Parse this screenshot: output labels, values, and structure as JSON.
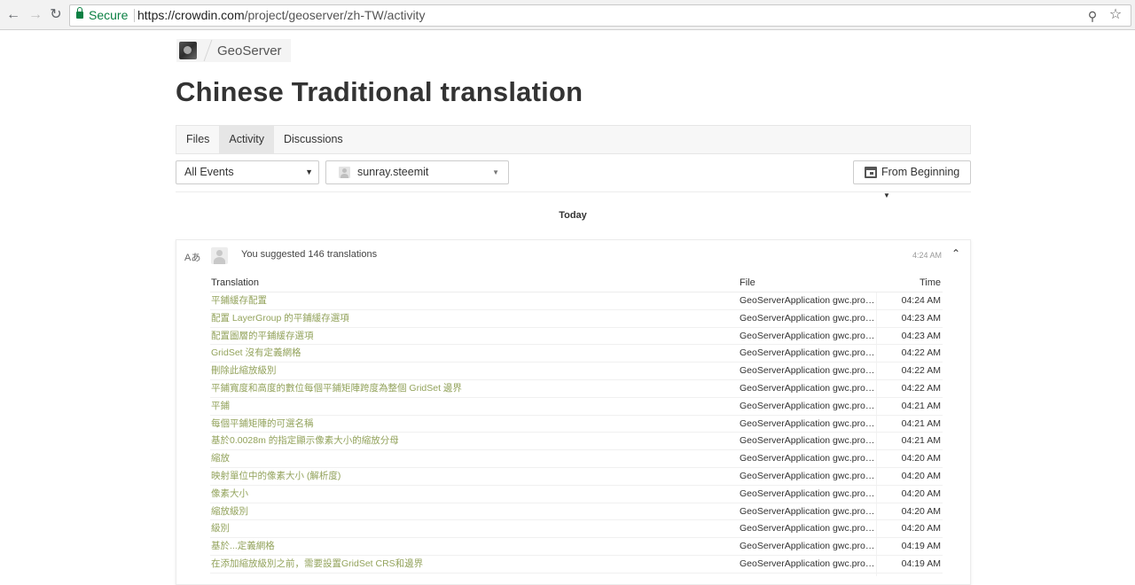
{
  "browser": {
    "secure_label": "Secure",
    "url_host": "https://crowdin.com",
    "url_path": "/project/geoserver/zh-TW/activity"
  },
  "breadcrumb": {
    "project": "GeoServer"
  },
  "page": {
    "title": "Chinese Traditional translation"
  },
  "tabs": [
    {
      "label": "Files",
      "active": false
    },
    {
      "label": "Activity",
      "active": true
    },
    {
      "label": "Discussions",
      "active": false
    }
  ],
  "filters": {
    "events": "All Events",
    "user": "sunray.steemit",
    "date": "From Beginning"
  },
  "day_label": "Today",
  "activity": {
    "summary": "You suggested 146 translations",
    "time": "4:24 AM",
    "columns": {
      "translation": "Translation",
      "file": "File",
      "time": "Time"
    },
    "rows": [
      {
        "translation": "平鋪緩存配置",
        "file": "GeoServerApplication gwc.properties",
        "time": "04:24 AM"
      },
      {
        "translation": "配置 LayerGroup 的平鋪緩存選項",
        "file": "GeoServerApplication gwc.properties",
        "time": "04:23 AM"
      },
      {
        "translation": "配置圖層的平鋪緩存選項",
        "file": "GeoServerApplication gwc.properties",
        "time": "04:23 AM"
      },
      {
        "translation": "GridSet 沒有定義網格",
        "file": "GeoServerApplication gwc.properties",
        "time": "04:22 AM"
      },
      {
        "translation": "刪除此縮放級別",
        "file": "GeoServerApplication gwc.properties",
        "time": "04:22 AM"
      },
      {
        "translation": "平鋪寬度和高度的數位每個平鋪矩陣跨度為整個 GridSet 邊界",
        "file": "GeoServerApplication gwc.properties",
        "time": "04:22 AM"
      },
      {
        "translation": "平鋪",
        "file": "GeoServerApplication gwc.properties",
        "time": "04:21 AM"
      },
      {
        "translation": "每個平鋪矩陣的可選名稱",
        "file": "GeoServerApplication gwc.properties",
        "time": "04:21 AM"
      },
      {
        "translation": "基於0.0028m 的指定顯示像素大小的縮放分母",
        "file": "GeoServerApplication gwc.properties",
        "time": "04:21 AM"
      },
      {
        "translation": "縮放",
        "file": "GeoServerApplication gwc.properties",
        "time": "04:20 AM"
      },
      {
        "translation": "映射單位中的像素大小 (解析度)",
        "file": "GeoServerApplication gwc.properties",
        "time": "04:20 AM"
      },
      {
        "translation": "像素大小",
        "file": "GeoServerApplication gwc.properties",
        "time": "04:20 AM"
      },
      {
        "translation": "縮放級別",
        "file": "GeoServerApplication gwc.properties",
        "time": "04:20 AM"
      },
      {
        "translation": "級別",
        "file": "GeoServerApplication gwc.properties",
        "time": "04:20 AM"
      },
      {
        "translation": "基於...定義網格",
        "file": "GeoServerApplication gwc.properties",
        "time": "04:19 AM"
      },
      {
        "translation": "在添加縮放級別之前，需要設置GridSet CRS和邊界",
        "file": "GeoServerApplication gwc.properties",
        "time": "04:19 AM"
      }
    ]
  }
}
